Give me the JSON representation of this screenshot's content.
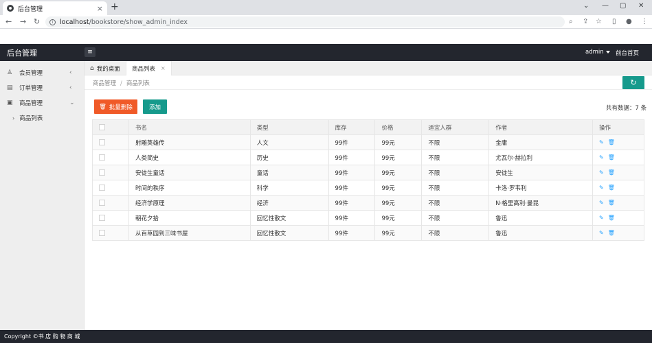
{
  "browser": {
    "tab_title": "后台管理",
    "tab_close": "×",
    "new_tab": "+",
    "url_host": "localhost",
    "url_path": "/bookstore/show_admin_index",
    "win_minimize": "—",
    "win_restore": "▢",
    "win_close": "✕"
  },
  "header": {
    "brand": "后台管理",
    "menu_toggle_icon": "≡",
    "user": "admin",
    "front_link": "前台首页"
  },
  "sidebar": {
    "items": [
      {
        "label": "会员管理",
        "icon": "user-icon",
        "expanded": false
      },
      {
        "label": "订单管理",
        "icon": "order-icon",
        "expanded": false
      },
      {
        "label": "商品管理",
        "icon": "goods-icon",
        "expanded": true
      }
    ],
    "sub_items": [
      {
        "label": "商品列表"
      }
    ]
  },
  "content_tabs": {
    "home_tab": "我的桌面",
    "active_tab": "商品列表",
    "close": "×"
  },
  "breadcrumb": {
    "parent": "商品管理",
    "sep": "/",
    "current": "商品列表"
  },
  "toolbar": {
    "delete_label": "批量删除",
    "add_label": "添加",
    "total_text": "共有数据：7 条"
  },
  "table": {
    "headers": [
      "书名",
      "类型",
      "库存",
      "价格",
      "适宜人群",
      "作者",
      "操作"
    ],
    "rows": [
      {
        "name": "射雕英雄传",
        "type": "人文",
        "stock": "99件",
        "price": "99元",
        "audience": "不限",
        "author": "金庸"
      },
      {
        "name": "人类简史",
        "type": "历史",
        "stock": "99件",
        "price": "99元",
        "audience": "不限",
        "author": "尤瓦尔·赫拉利"
      },
      {
        "name": "安徒生童话",
        "type": "童话",
        "stock": "99件",
        "price": "99元",
        "audience": "不限",
        "author": "安徒生"
      },
      {
        "name": "时间的秩序",
        "type": "科学",
        "stock": "99件",
        "price": "99元",
        "audience": "不限",
        "author": "卡洛·罗韦利"
      },
      {
        "name": "经济学原理",
        "type": "经济",
        "stock": "99件",
        "price": "99元",
        "audience": "不限",
        "author": "N·格里高利·曼昆"
      },
      {
        "name": "朝花夕拾",
        "type": "回忆性散文",
        "stock": "99件",
        "price": "99元",
        "audience": "不限",
        "author": "鲁迅"
      },
      {
        "name": "从百草园到三味书屋",
        "type": "回忆性散文",
        "stock": "99件",
        "price": "99元",
        "audience": "不限",
        "author": "鲁迅"
      }
    ]
  },
  "footer": {
    "text": "Copyright ©书 店 购 物 商 城"
  },
  "colors": {
    "header_bg": "#23262e",
    "accent_green": "#169a8c",
    "danger_orange": "#f05a28",
    "link_blue": "#1E9FFF"
  }
}
